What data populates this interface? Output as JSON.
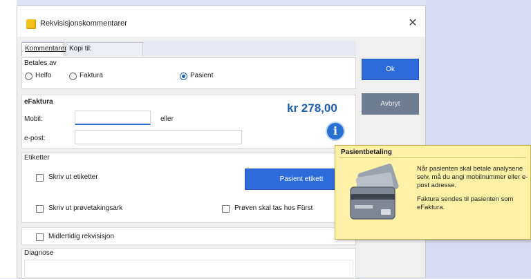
{
  "dialog": {
    "title": "Rekvisisjonskommentarer",
    "close_glyph": "✕"
  },
  "tabs": [
    {
      "label": "Kommentarer"
    },
    {
      "label": "Kopi til:"
    }
  ],
  "payment": {
    "group_label": "Betales av",
    "options": [
      {
        "label": "Helfo",
        "selected": false
      },
      {
        "label": "Faktura",
        "selected": false
      },
      {
        "label": "Pasient",
        "selected": true
      }
    ]
  },
  "efaktura": {
    "group_label": "eFaktura",
    "mobile_label": "Mobil:",
    "mobile_value": "",
    "or_label": "eller",
    "email_label": "e-post:",
    "email_value": "",
    "amount": "kr 278,00",
    "info_glyph": "i"
  },
  "labels_section": {
    "group_label": "Etiketter",
    "print_labels": "Skriv ut etiketter",
    "patient_label_button": "Pasient etikett",
    "print_sample_card": "Skriv ut prøvetakingsark",
    "sample_taken_at": "Prøven skal tas hos Fürst"
  },
  "temp_requisition": {
    "label": "Midlertidig rekvisisjon"
  },
  "diagnosis": {
    "group_label": "Diagnose"
  },
  "buttons": {
    "ok": "Ok",
    "cancel": "Avbryt"
  },
  "tooltip": {
    "title": "Pasientbetaling",
    "icon": "credit-card-icon",
    "paragraph1": "Når pasienten skal betale analysene selv, må du angi mobilnummer eller e-post adresse.",
    "paragraph2": "Faktura sendes til pasienten som eFaktura."
  },
  "colors": {
    "accent": "#2c6bd9",
    "amount": "#1d5fae",
    "tooltip_bg": "#fdf1a8"
  }
}
